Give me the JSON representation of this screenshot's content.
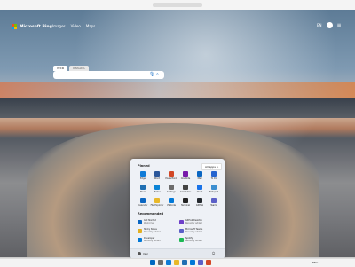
{
  "bing": {
    "logo_text": "Microsoft Bing",
    "nav": [
      "Images",
      "Video",
      "Maps"
    ],
    "lang": "EN",
    "search_tabs": [
      "WEB",
      "IMAGES"
    ],
    "search_placeholder": ""
  },
  "start_menu": {
    "pinned_title": "Pinned",
    "all_apps_label": "All apps >",
    "pinned_apps": [
      {
        "label": "Edge",
        "color": "#0f7bd7"
      },
      {
        "label": "Word",
        "color": "#2b579a"
      },
      {
        "label": "PowerPoint",
        "color": "#d24726"
      },
      {
        "label": "OneNote",
        "color": "#7719aa"
      },
      {
        "label": "Mail",
        "color": "#0a66c2"
      },
      {
        "label": "To Do",
        "color": "#2564cf"
      },
      {
        "label": "Store",
        "color": "#1f6fb3"
      },
      {
        "label": "Photos",
        "color": "#0a84d6"
      },
      {
        "label": "Settings",
        "color": "#6c6c6c"
      },
      {
        "label": "Calculator",
        "color": "#444"
      },
      {
        "label": "Clock",
        "color": "#1a73e8"
      },
      {
        "label": "Notepad",
        "color": "#3b8ed0"
      },
      {
        "label": "Calendar",
        "color": "#0a66c2"
      },
      {
        "label": "File Explorer",
        "color": "#e8b829"
      },
      {
        "label": "VS Code",
        "color": "#0078d7"
      },
      {
        "label": "Terminal",
        "color": "#222"
      },
      {
        "label": "GitHub",
        "color": "#24292e"
      },
      {
        "label": "Teams",
        "color": "#5b5fc7"
      }
    ],
    "recommended_title": "Recommended",
    "recommended": [
      {
        "label": "Get Started",
        "sub": "Welcome",
        "color": "#0a66c2"
      },
      {
        "label": "GitHub Desktop",
        "sub": "Recently added",
        "color": "#6e40c9"
      },
      {
        "label": "Sticky Notes",
        "sub": "Recently added",
        "color": "#e3b022"
      },
      {
        "label": "Microsoft Teams",
        "sub": "Recently added",
        "color": "#5b5fc7"
      },
      {
        "label": "Developer",
        "sub": "Recently added",
        "color": "#0078d7"
      },
      {
        "label": "Spotify",
        "sub": "Recently added",
        "color": "#1db954"
      }
    ],
    "user_name": "User",
    "power_icon": "power-icon"
  },
  "taskbar": {
    "icons": [
      "#0067c0",
      "#6c6c6c",
      "#0f7bd7",
      "#e8b829",
      "#1f6fb3",
      "#0078d7",
      "#5b5fc7",
      "#d24726"
    ],
    "tray_text": "ENG"
  }
}
